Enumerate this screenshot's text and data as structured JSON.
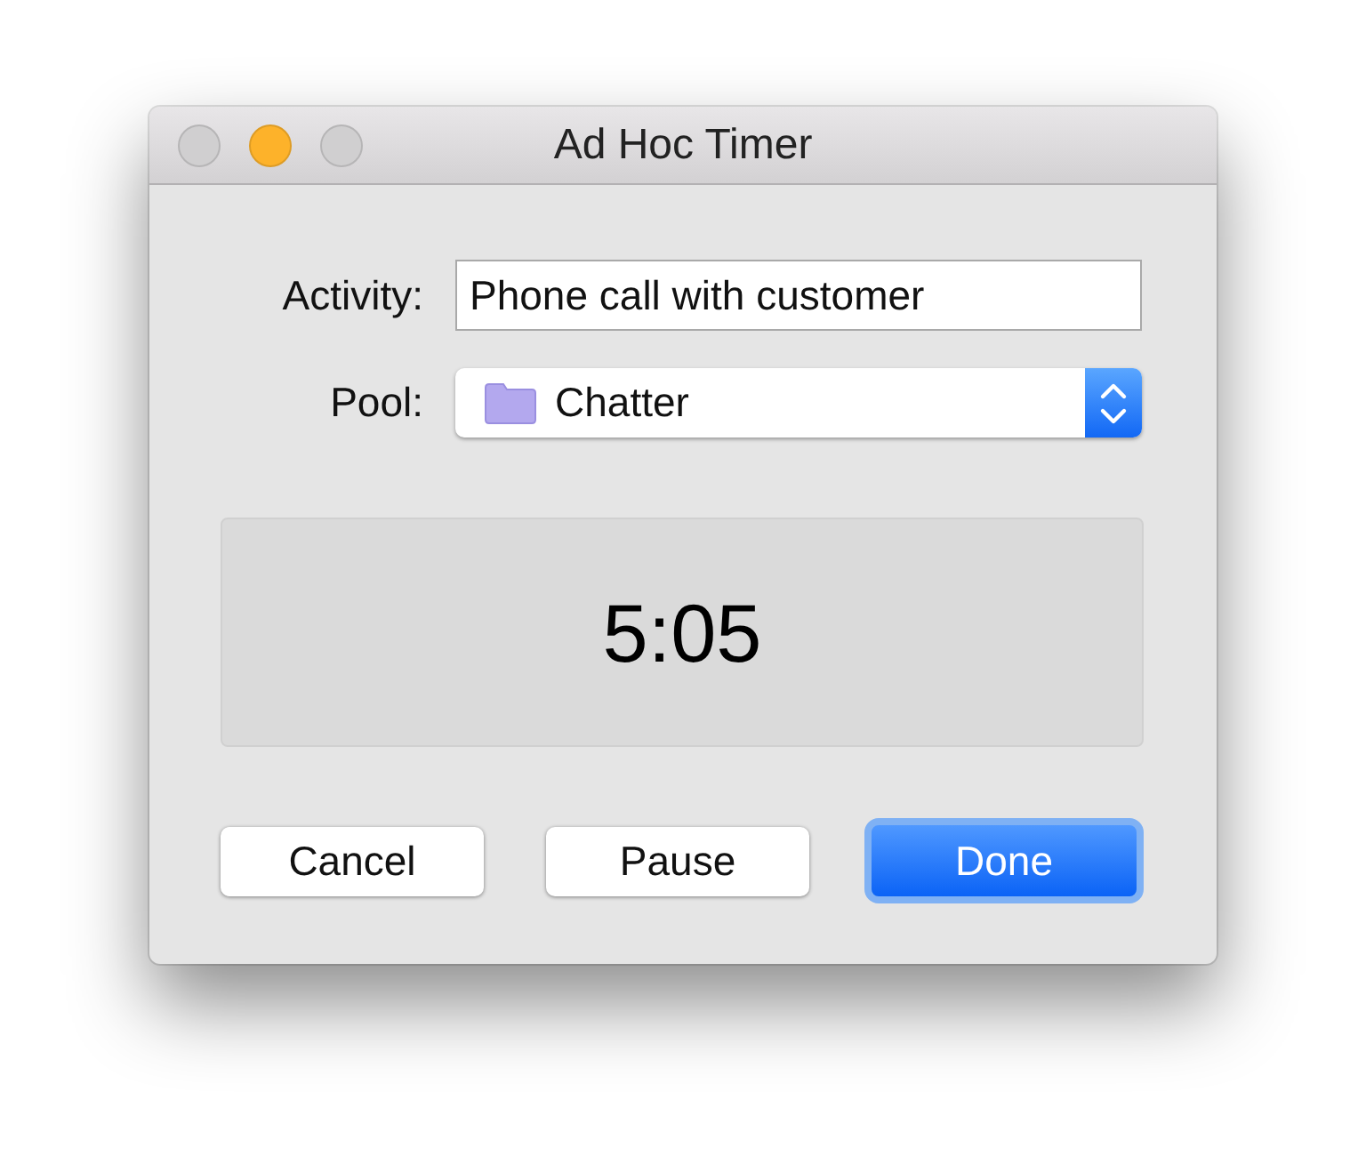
{
  "window": {
    "title": "Ad Hoc Timer",
    "traffic_lights": [
      {
        "color": "#d0cfd0"
      },
      {
        "color": "#fdb22a"
      },
      {
        "color": "#d0cfd0"
      }
    ]
  },
  "form": {
    "activity": {
      "label": "Activity:",
      "value": "Phone call with customer"
    },
    "pool": {
      "label": "Pool:",
      "value": "Chatter"
    }
  },
  "timer": {
    "display": "5:05"
  },
  "buttons": [
    {
      "label": "Cancel",
      "kind": "normal"
    },
    {
      "label": "Pause",
      "kind": "normal"
    },
    {
      "label": "Done",
      "kind": "default"
    }
  ]
}
